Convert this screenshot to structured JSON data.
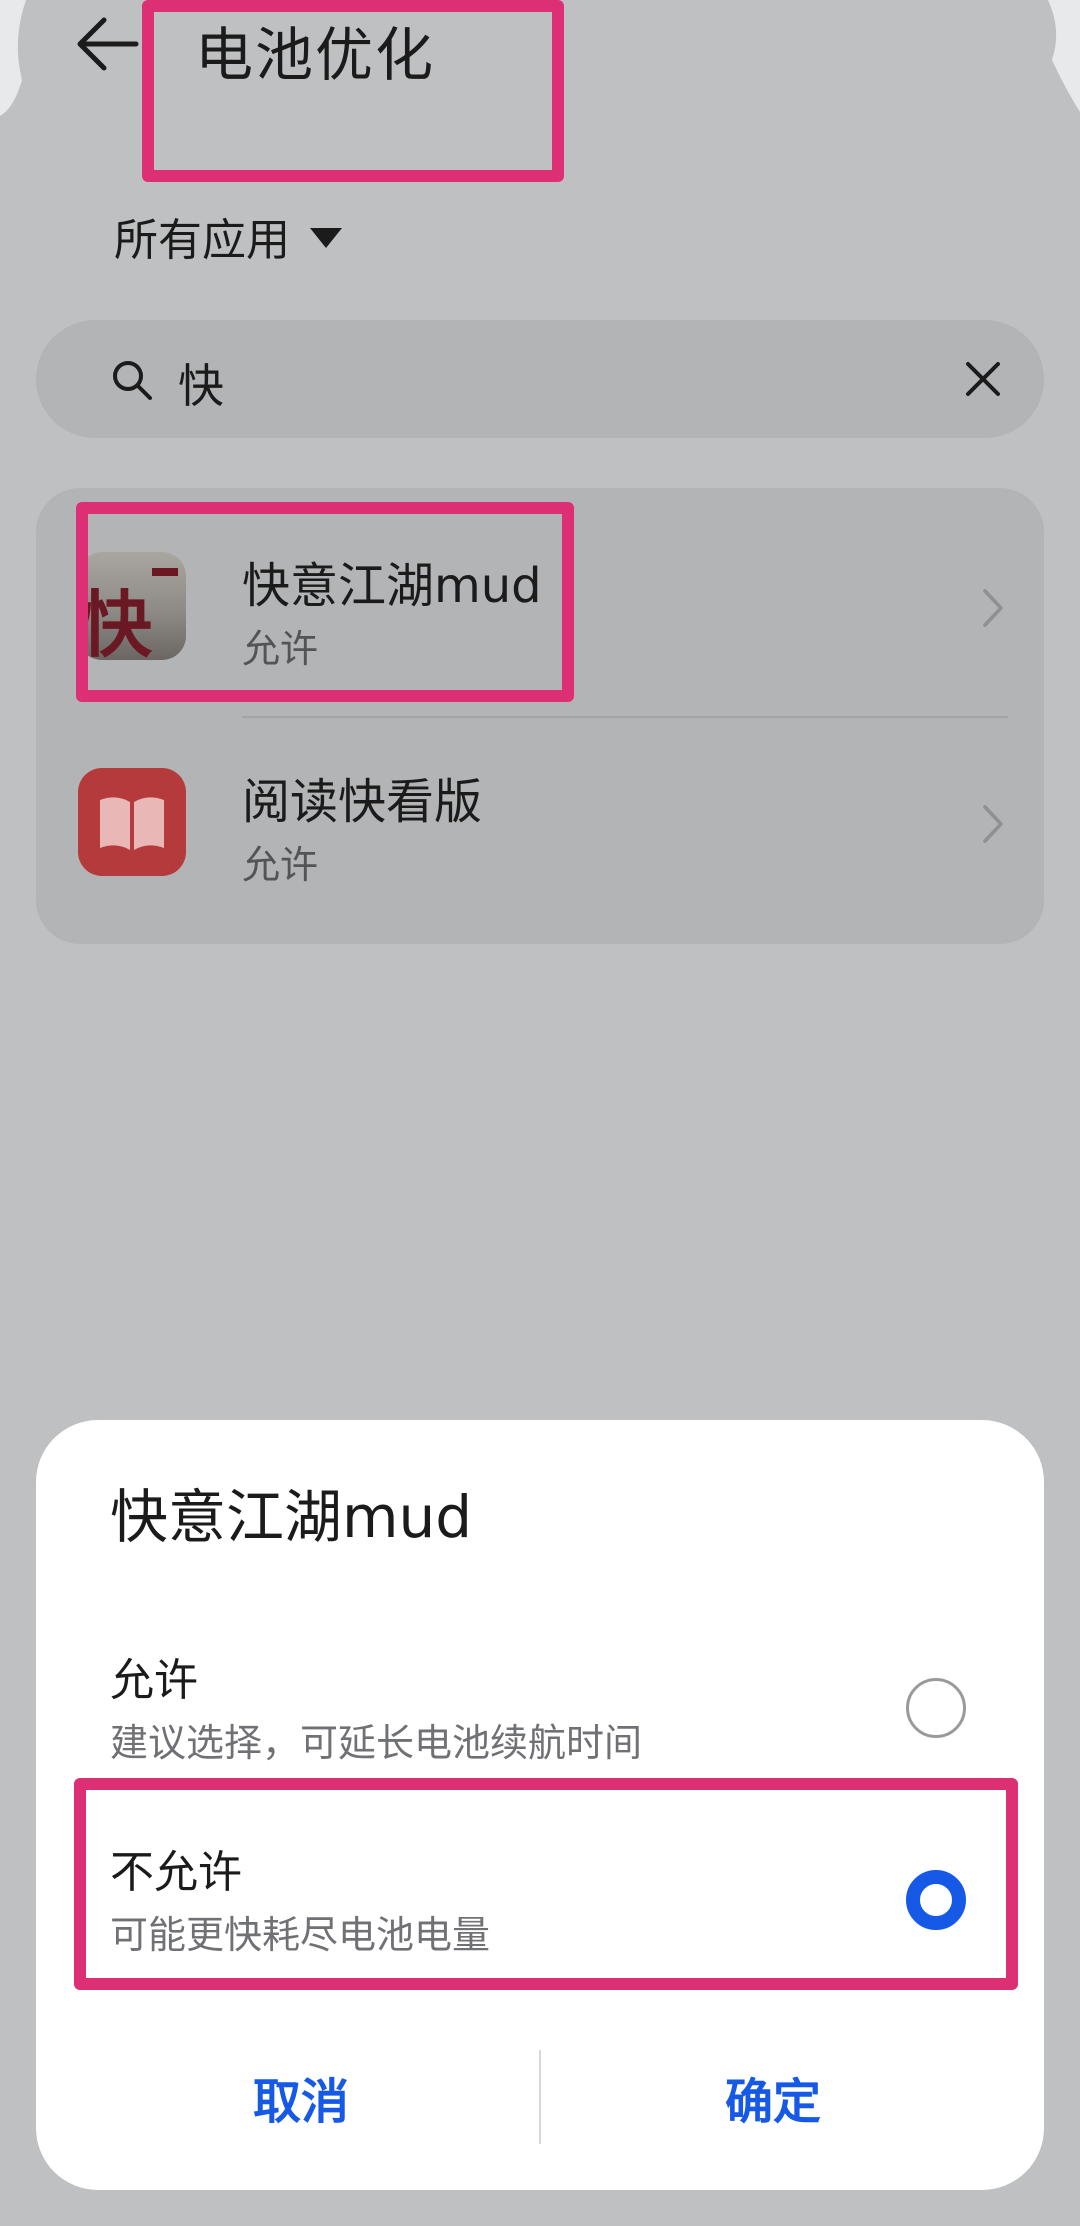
{
  "header": {
    "title": "电池优化",
    "back_icon": "arrow-left-icon"
  },
  "filter": {
    "label": "所有应用",
    "caret_icon": "caret-down-icon"
  },
  "search": {
    "value": "快",
    "search_icon": "search-icon",
    "clear_icon": "close-icon"
  },
  "apps": [
    {
      "name": "快意江湖mud",
      "status": "允许",
      "icon": "kuaiyi-jianghu-app-icon"
    },
    {
      "name": "阅读快看版",
      "status": "允许",
      "icon": "book-app-icon"
    }
  ],
  "dialog": {
    "title": "快意江湖mud",
    "options": [
      {
        "label": "允许",
        "description": "建议选择，可延长电池续航时间",
        "selected": false
      },
      {
        "label": "不允许",
        "description": "可能更快耗尽电池电量",
        "selected": true
      }
    ],
    "cancel_label": "取消",
    "confirm_label": "确定"
  },
  "colors": {
    "scrim_background": "#bfc0c2",
    "accent": "#1659e6",
    "highlight": "#dd2f74"
  }
}
